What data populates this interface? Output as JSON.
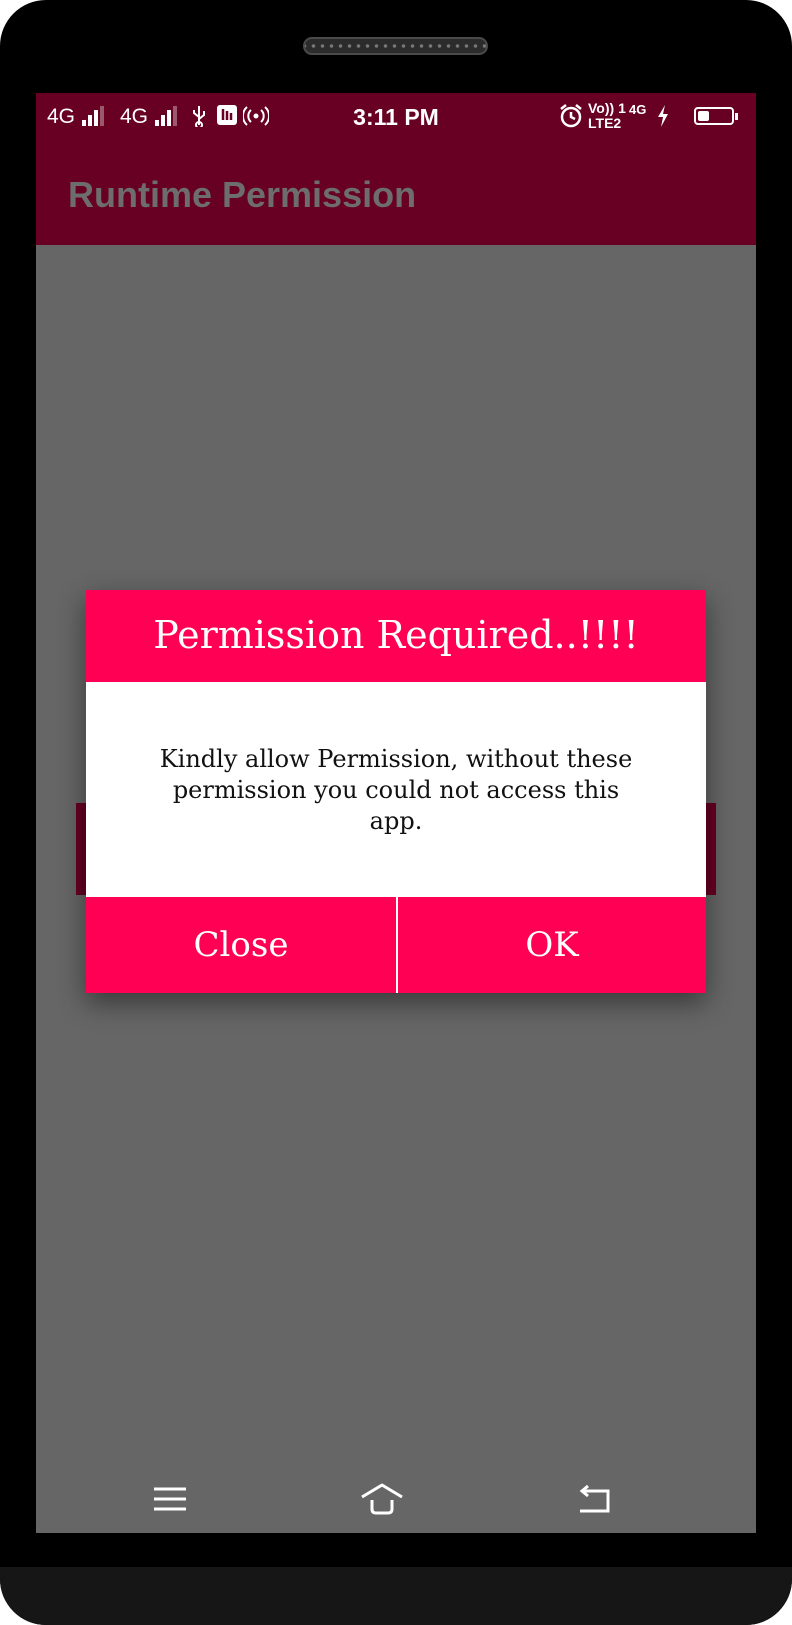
{
  "status_bar": {
    "network1": "4G",
    "network2": "4G",
    "time": "3:11 PM",
    "volte_top": "Vo)) 1",
    "volte_bottom": "LTE2",
    "network3": "4G",
    "battery_level_pct": 35
  },
  "app_bar": {
    "title": "Runtime Permission"
  },
  "dialog": {
    "title": "Permission Required..!!!!",
    "message": "Kindly allow Permission, without these permission you could not access this app.",
    "close_label": "Close",
    "ok_label": "OK"
  },
  "nav_bar": {
    "icons": [
      "menu-icon",
      "home-icon",
      "back-icon"
    ]
  },
  "colors": {
    "app_bar": "#670022",
    "dialog_accent": "#ff0055",
    "screen_dim": "#666666"
  }
}
